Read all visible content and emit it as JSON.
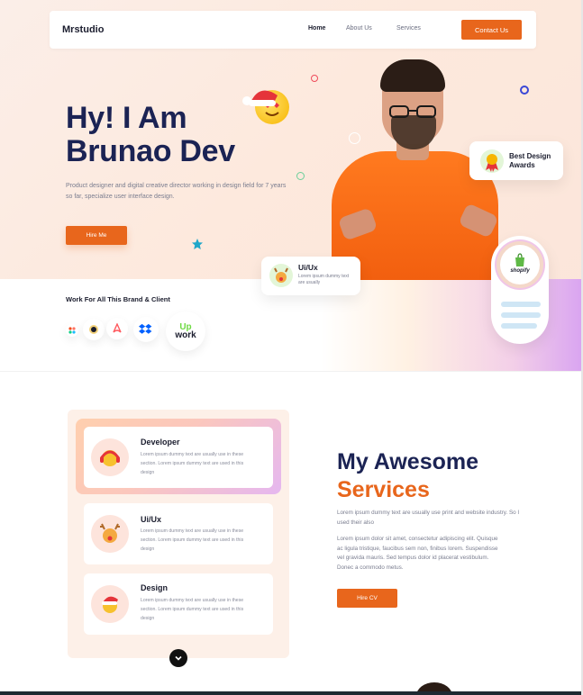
{
  "nav": {
    "brand": "Mrstudio",
    "links": [
      "Home",
      "About Us",
      "Services"
    ],
    "contact_label": "Contact Us"
  },
  "hero": {
    "title_line1": "Hy! I Am",
    "title_line2": "Brunao Dev",
    "description": "Product designer and digital creative director working in design field for 7 years so far, specialize user interface design.",
    "hire_label": "Hire Me"
  },
  "badges": {
    "award_line1": "Best Design",
    "award_line2": "Awards",
    "uiux_title": "Ui/Ux",
    "uiux_sub": "Lorem ipsum dummy text are usually",
    "shopify": "shopify"
  },
  "brands": {
    "heading": "Work For All This Brand & Client",
    "upwork_line1": "Up",
    "upwork_line2": "work"
  },
  "services": {
    "cards": [
      {
        "title": "Developer",
        "desc": "Lorem ipsum dummy text are usually use in these section. Lorem ipsum dummy text are used in this design"
      },
      {
        "title": "Ui/Ux",
        "desc": "Lorem ipsum dummy text are usually use in these section. Lorem ipsum dummy text are used in this design"
      },
      {
        "title": "Design",
        "desc": "Lorem ipsum dummy text are usually use in these section. Lorem ipsum dummy text are used in this design"
      }
    ],
    "heading_line1": "My Awesome",
    "heading_line2": "Services",
    "para1": "Lorem ipsum dummy text are usually use print and website industry. So I used their also",
    "para2": "Lorem ipsum dolor sit amet, consectetur adipiscing elit. Quisque ac ligula tristique, faucibus sem non, finibus lorem. Suspendisse vel gravida mauris. Sed tempus dolor id placerat vestibulum. Donec a commodo metus.",
    "hire_cv_label": "Hire CV"
  },
  "colors": {
    "accent": "#e8661c",
    "navy": "#1b2354"
  }
}
